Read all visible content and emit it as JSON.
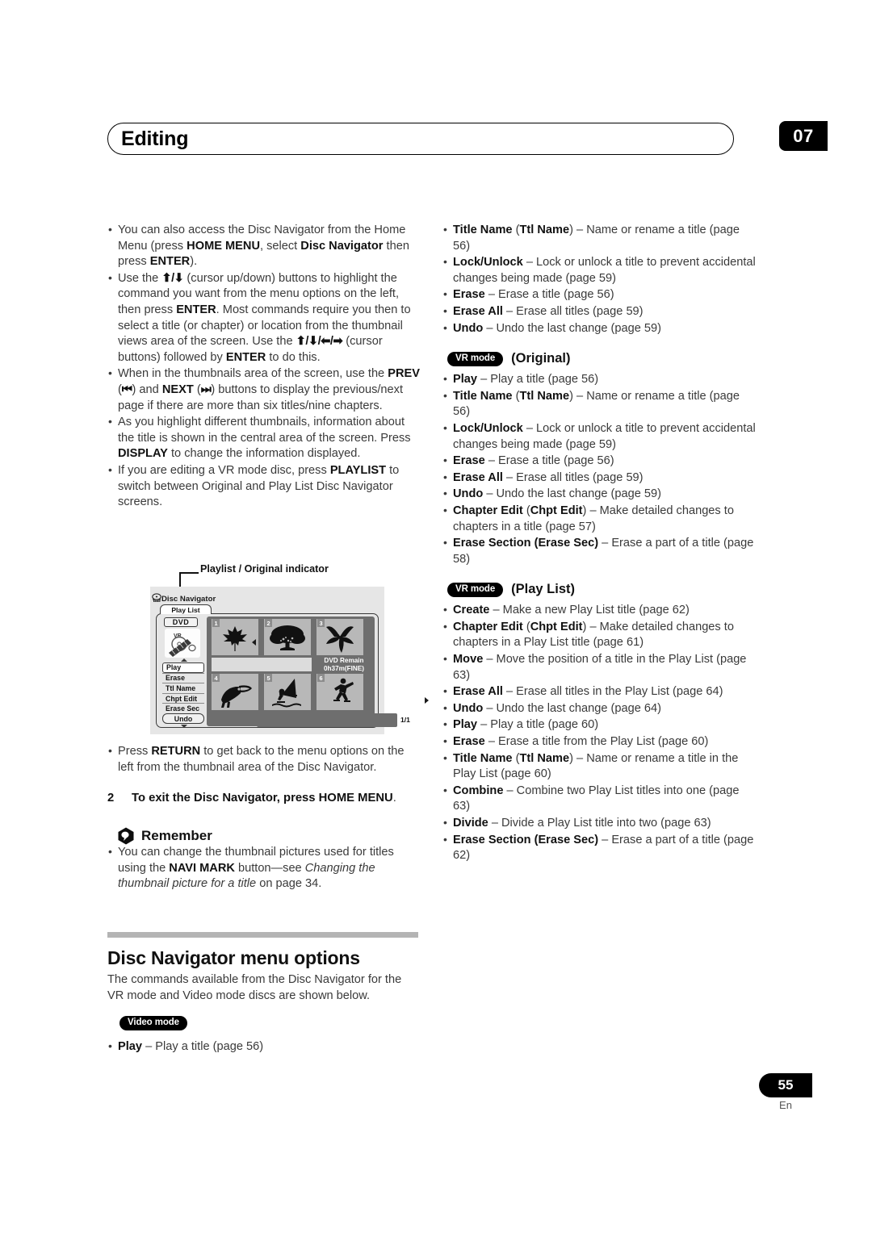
{
  "header": {
    "title": "Editing",
    "chapter_number": "07"
  },
  "footer": {
    "page_number": "55",
    "language": "En"
  },
  "left_column": {
    "bullets": [
      {
        "id": "home-menu-access",
        "html": "You can also access the Disc Navigator from the Home Menu (press <b>HOME MENU</b>, select <b>Disc Navigator</b> then press <b>ENTER</b>)."
      },
      {
        "id": "cursor-buttons",
        "html": "Use the <span class=\"arrow\">&#11014;/&#11015;</span> (cursor up/down) buttons to highlight the command you want from the menu options on the left, then press <b>ENTER</b>. Most commands require you then to select a title (or chapter) or location from the thumbnail views area of the screen. Use the <span class=\"arrow\">&#11014;/&#11015;/&#11013;/&#10145;</span> (cursor buttons) followed by <b>ENTER</b> to do this."
      },
      {
        "id": "prev-next-paging",
        "html": "When in the thumbnails area of the screen, use the <b>PREV</b> (<span class=\"arrow\">&#9198;</span>) and <b>NEXT</b> (<span class=\"arrow\">&#9197;</span>) buttons to display the previous/next page if there are more than six titles/nine chapters."
      },
      {
        "id": "display-info",
        "html": "As you highlight different thumbnails, information about the title is shown in the central area of the screen. Press <b>DISPLAY</b> to change the information displayed."
      },
      {
        "id": "playlist-switch",
        "html": "If you are editing a VR mode disc, press <b>PLAYLIST</b> to switch between Original and Play List Disc Navigator screens."
      }
    ],
    "bullets_after_figure": [
      {
        "id": "return-button",
        "html": "Press <b>RETURN</b> to get back to the menu options on the left from the thumbnail area of the Disc Navigator."
      }
    ],
    "step": {
      "number": "2",
      "text": "To exit the Disc Navigator, press HOME MENU",
      "tail": "."
    },
    "remember": {
      "label": "Remember",
      "bullets": [
        {
          "id": "navi-mark",
          "html": "You can change the thumbnail pictures used for titles using the <b>NAVI MARK</b> button&#8212;see <i>Changing the thumbnail picture for a title</i> on page 34."
        }
      ]
    },
    "section": {
      "title": "Disc Navigator menu options",
      "intro": "The commands available from the Disc Navigator for the VR mode and Video mode discs are shown below."
    },
    "video_mode": {
      "badge": "Video mode",
      "bullets": [
        {
          "id": "video-play",
          "html": "<b>Play</b> &#8211; Play a title (page 56)"
        }
      ]
    }
  },
  "figure": {
    "callout_label": "Playlist / Original indicator",
    "screen": {
      "title": "Disc Navigator",
      "tab_label": "Play List",
      "disc_chip": "DVD",
      "disc_mode": "VR",
      "menu_items": [
        {
          "label": "Play",
          "selected": true
        },
        {
          "label": "Erase",
          "selected": false
        },
        {
          "label": "Ttl Name",
          "selected": false
        },
        {
          "label": "Chpt Edit",
          "selected": false
        },
        {
          "label": "Erase Sec",
          "selected": false
        }
      ],
      "undo_button": "Undo",
      "thumbnails": [
        {
          "number": "1",
          "icon": "maple-leaf-icon"
        },
        {
          "number": "2",
          "icon": "tree-icon"
        },
        {
          "number": "3",
          "icon": "lily-flower-icon"
        },
        {
          "number": "4",
          "icon": "toucan-icon"
        },
        {
          "number": "5",
          "icon": "windsurfer-icon"
        },
        {
          "number": "6",
          "icon": "inline-skater-icon"
        }
      ],
      "remain_line1": "DVD Remain",
      "remain_line2": "0h37m(FINE)",
      "page_count": "1/1"
    }
  },
  "right_column": {
    "top_bullets": [
      {
        "id": "video-title-name",
        "html": "<b>Title Name</b> (<b>Ttl Name</b>) &#8211; Name or rename a title (page 56)"
      },
      {
        "id": "video-lock-unlock",
        "html": "<b>Lock/Unlock</b> &#8211; Lock or unlock a title to prevent accidental changes being made (page 59)"
      },
      {
        "id": "video-erase",
        "html": "<b>Erase</b> &#8211; Erase a title (page 56)"
      },
      {
        "id": "video-erase-all",
        "html": "<b>Erase All</b> &#8211; Erase all titles (page 59)"
      },
      {
        "id": "video-undo",
        "html": "<b>Undo</b> &#8211; Undo the last change (page 59)"
      }
    ],
    "original": {
      "badge": "VR mode",
      "caption": "(Original)",
      "bullets": [
        {
          "id": "orig-play",
          "html": "<b>Play</b> &#8211; Play a title (page 56)"
        },
        {
          "id": "orig-title-name",
          "html": "<b>Title Name</b> (<b>Ttl Name</b>) &#8211; Name or rename a title (page 56)"
        },
        {
          "id": "orig-lock-unlock",
          "html": "<b>Lock/Unlock</b> &#8211; Lock or unlock a title to prevent accidental changes being made (page 59)"
        },
        {
          "id": "orig-erase",
          "html": "<b>Erase</b> &#8211; Erase a title (page 56)"
        },
        {
          "id": "orig-erase-all",
          "html": "<b>Erase All</b> &#8211; Erase all titles (page 59)"
        },
        {
          "id": "orig-undo",
          "html": "<b>Undo</b> &#8211; Undo the last change (page 59)"
        },
        {
          "id": "orig-chapter-edit",
          "html": "<b>Chapter Edit</b> (<b>Chpt Edit</b>) &#8211; Make detailed changes to chapters in a title (page 57)"
        },
        {
          "id": "orig-erase-section",
          "html": "<b>Erase Section (Erase Sec)</b> &#8211; Erase a part of a title (page 58)"
        }
      ]
    },
    "play_list": {
      "badge": "VR mode",
      "caption": "(Play List)",
      "bullets": [
        {
          "id": "pl-create",
          "html": "<b>Create</b> &#8211; Make a new Play List title (page 62)"
        },
        {
          "id": "pl-chapter-edit",
          "html": "<b>Chapter Edit</b> (<b>Chpt Edit</b>) &#8211; Make detailed changes to chapters in a Play List title (page 61)"
        },
        {
          "id": "pl-move",
          "html": "<b>Move</b> &#8211; Move the position of a title in the Play List (page 63)"
        },
        {
          "id": "pl-erase-all",
          "html": "<b>Erase All</b> &#8211; Erase all titles in the Play List (page 64)"
        },
        {
          "id": "pl-undo",
          "html": "<b>Undo</b> &#8211; Undo the last change (page 64)"
        },
        {
          "id": "pl-play",
          "html": "<b>Play</b> &#8211; Play a title (page 60)"
        },
        {
          "id": "pl-erase",
          "html": "<b>Erase</b> &#8211; Erase a title from the Play List (page 60)"
        },
        {
          "id": "pl-title-name",
          "html": "<b>Title Name</b> (<b>Ttl Name</b>) &#8211; Name or rename a title in the Play List (page 60)"
        },
        {
          "id": "pl-combine",
          "html": "<b>Combine</b> &#8211; Combine two Play List titles into one (page 63)"
        },
        {
          "id": "pl-divide",
          "html": "<b>Divide</b> &#8211; Divide a Play List title into two (page 63)"
        },
        {
          "id": "pl-erase-section",
          "html": "<b>Erase Section (Erase Sec)</b> &#8211; Erase a part of a title (page 62)"
        }
      ]
    }
  }
}
